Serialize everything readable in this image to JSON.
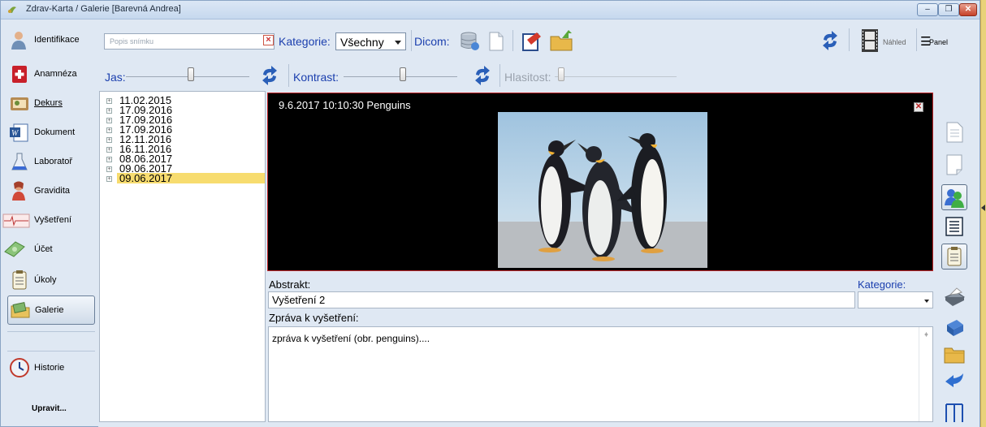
{
  "window": {
    "title": "Zdrav-Karta / Galerie [Barevná Andrea]",
    "min_label": "‒",
    "max_label": "❐",
    "close_label": "✕"
  },
  "sidebar": {
    "items": [
      {
        "label": "Identifikace",
        "icon": "person-icon"
      },
      {
        "label": "Anamnéza",
        "icon": "medical-kit-icon"
      },
      {
        "label": "Dekurs",
        "icon": "notebook-icon"
      },
      {
        "label": "Dokument",
        "icon": "word-document-icon"
      },
      {
        "label": "Laboratoř",
        "icon": "flask-icon"
      },
      {
        "label": "Gravidita",
        "icon": "woman-icon"
      },
      {
        "label": "Vyšetření",
        "icon": "ekg-icon"
      },
      {
        "label": "Účet",
        "icon": "money-icon"
      },
      {
        "label": "Úkoly",
        "icon": "clipboard-icon"
      },
      {
        "label": "Galerie",
        "icon": "gallery-icon"
      },
      {
        "label": "Historie",
        "icon": "clock-icon"
      }
    ],
    "upravit": "Upravit..."
  },
  "toolbar": {
    "search_placeholder": "Popis snímku",
    "kategorie_label": "Kategorie:",
    "kategorie_value": "Všechny",
    "dicom_label": "Dicom:",
    "nahled_label": "Náhled",
    "panel_label": "Panel",
    "panel_glyph": "☰"
  },
  "sliders": {
    "jas_label": "Jas:",
    "kontrast_label": "Kontrast:",
    "hlasitost_label": "Hlasitost:"
  },
  "tree": {
    "dates": [
      "11.02.2015",
      "17.09.2016",
      "17.09.2016",
      "17.09.2016",
      "12.11.2016",
      "16.11.2016",
      "08.06.2017",
      "09.06.2017",
      "09.06.2017"
    ],
    "selected_index": 8
  },
  "viewer": {
    "caption": "9.6.2017 10:10:30 Penguins",
    "close_label": "✕"
  },
  "details": {
    "abstrakt_label": "Abstrakt:",
    "abstrakt_value": "Vyšetření 2",
    "kategorie_label": "Kategorie:",
    "kategorie_value": "",
    "zprava_label": "Zpráva k vyšetření:",
    "zprava_value": "zpráva k vyšetření (obr. penguins)...."
  },
  "colors": {
    "accent_blue": "#1b3fae",
    "selection": "#f7dc6f",
    "viewer_border": "#c0262a",
    "window_bg": "#dfe8f3"
  }
}
